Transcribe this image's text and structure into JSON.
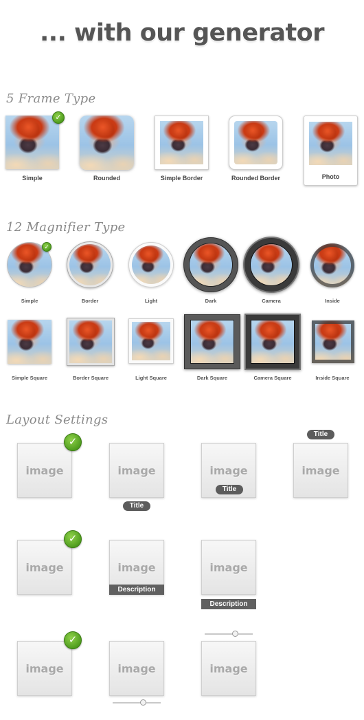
{
  "heading": "... with our generator",
  "frame_section": {
    "title": "5 Frame Type",
    "items": [
      "Simple",
      "Rounded",
      "Simple Border",
      "Rounded Border",
      "Photo"
    ]
  },
  "magnifier_section": {
    "title": "12 Magnifier Type",
    "round_items": [
      "Simple",
      "Border",
      "Light",
      "Dark",
      "Camera",
      "Inside"
    ],
    "square_items": [
      "Simple Square",
      "Border Square",
      "Light Square",
      "Dark Square",
      "Camera Square",
      "Inside Square"
    ]
  },
  "layout_section": {
    "title": "Layout Settings",
    "image_placeholder": "image",
    "title_label": "Title",
    "description_label": "Description"
  },
  "colors": {
    "check_green": "#5aa51f",
    "pill_gray": "#5c5c5c",
    "heading_gray": "#555555"
  }
}
